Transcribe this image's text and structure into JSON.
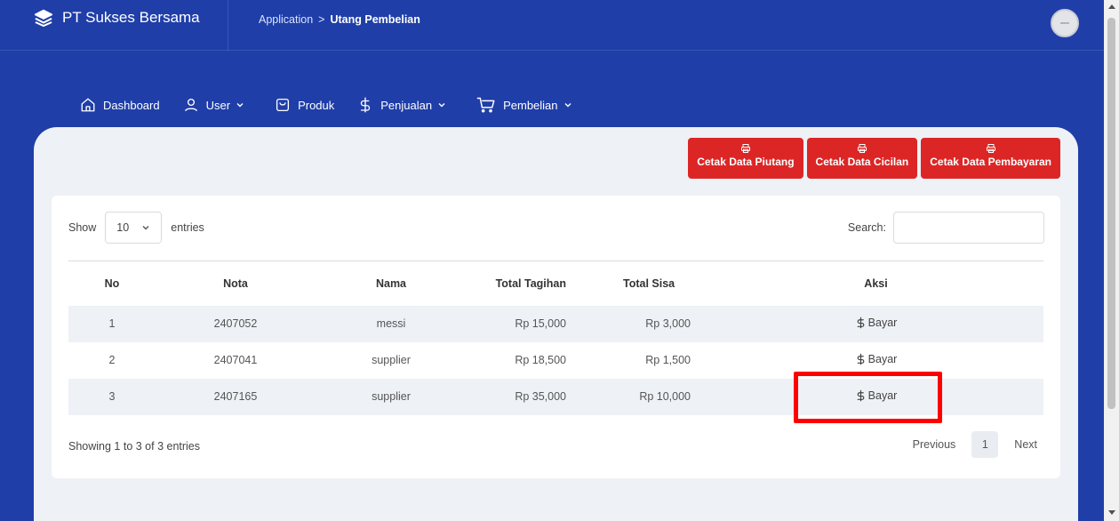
{
  "header": {
    "brand": "PT Sukses Bersama",
    "breadcrumb_parent": "Application",
    "breadcrumb_separator": ">",
    "breadcrumb_current": "Utang Pembelian"
  },
  "nav": {
    "dashboard": "Dashboard",
    "user": "User",
    "produk": "Produk",
    "penjualan": "Penjualan",
    "pembelian": "Pembelian"
  },
  "actions": {
    "cetak_piutang": "Cetak Data Piutang",
    "cetak_cicilan": "Cetak Data Cicilan",
    "cetak_pembayaran": "Cetak Data Pembayaran"
  },
  "table_controls": {
    "show_label": "Show",
    "length_value": "10",
    "entries_label": "entries",
    "search_label": "Search:"
  },
  "table": {
    "headers": [
      "No",
      "Nota",
      "Nama",
      "Total Tagihan",
      "Total Sisa",
      "Aksi"
    ],
    "rows": [
      {
        "no": "1",
        "nota": "2407052",
        "nama": "messi",
        "total_tagihan": "Rp 15,000",
        "total_sisa": "Rp 3,000",
        "aksi": "Bayar"
      },
      {
        "no": "2",
        "nota": "2407041",
        "nama": "supplier",
        "total_tagihan": "Rp 18,500",
        "total_sisa": "Rp 1,500",
        "aksi": "Bayar"
      },
      {
        "no": "3",
        "nota": "2407165",
        "nama": "supplier",
        "total_tagihan": "Rp 35,000",
        "total_sisa": "Rp 10,000",
        "aksi": "Bayar"
      }
    ]
  },
  "footer": {
    "info": "Showing 1 to 3 of 3 entries",
    "previous": "Previous",
    "page": "1",
    "next": "Next"
  },
  "colors": {
    "background": "#1f3ea8",
    "accent_red": "#dc2626",
    "highlight": "#ff0000"
  }
}
